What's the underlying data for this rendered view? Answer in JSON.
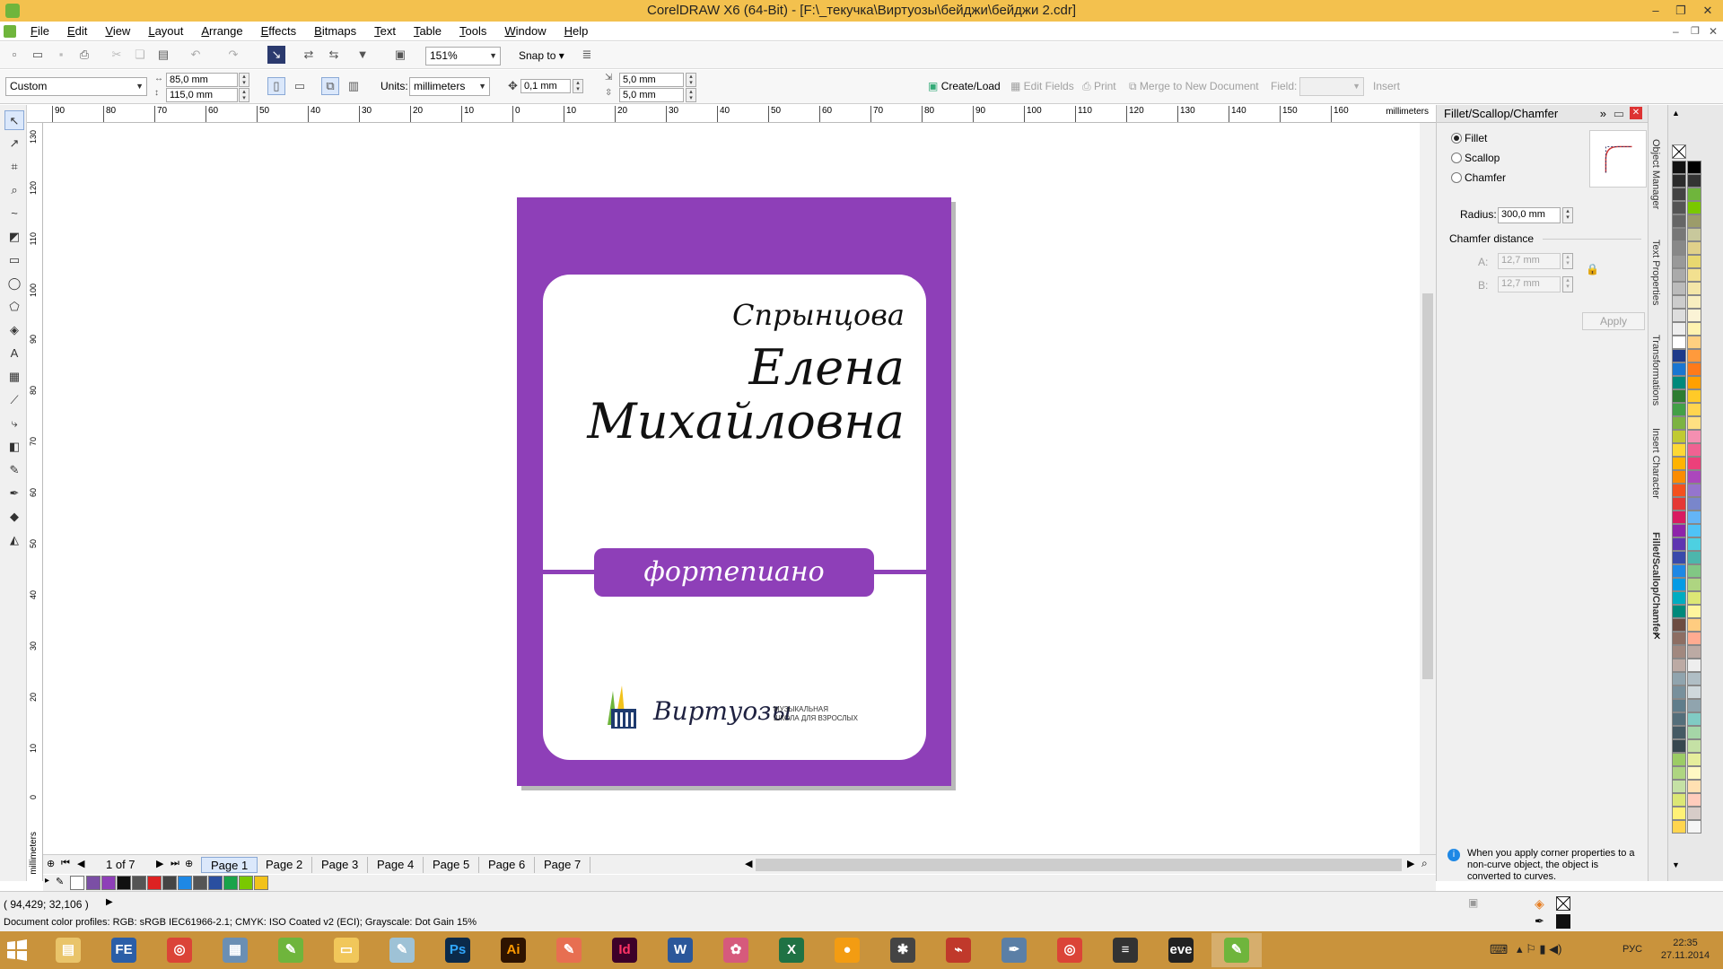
{
  "titlebar": {
    "title": "CorelDRAW X6 (64-Bit) - [F:\\_текучка\\Виртуозы\\бейджи\\бейджи 2.cdr]"
  },
  "menu": [
    "File",
    "Edit",
    "View",
    "Layout",
    "Arrange",
    "Effects",
    "Bitmaps",
    "Text",
    "Table",
    "Tools",
    "Window",
    "Help"
  ],
  "toolbar": {
    "zoom": "151%",
    "snap_to": "Snap to"
  },
  "propbar": {
    "preset": "Custom",
    "width": "85,0 mm",
    "height": "115,0 mm",
    "units_label": "Units:",
    "units": "millimeters",
    "nudge": "0,1 mm",
    "dup_x": "5,0 mm",
    "dup_y": "5,0 mm",
    "create_load": "Create/Load",
    "edit_fields": "Edit Fields",
    "print": "Print",
    "merge": "Merge to New Document",
    "field_label": "Field:",
    "insert": "Insert"
  },
  "rulers": {
    "h_ticks": [
      "90",
      "80",
      "70",
      "60",
      "50",
      "40",
      "30",
      "20",
      "10",
      "0",
      "10",
      "20",
      "30",
      "40",
      "50",
      "60",
      "70",
      "80",
      "90",
      "100",
      "110",
      "120",
      "130",
      "140",
      "150",
      "160"
    ],
    "units": "millimeters",
    "v_ticks": [
      "130",
      "120",
      "110",
      "100",
      "90",
      "80",
      "70",
      "60",
      "50",
      "40",
      "30",
      "20",
      "10",
      "0"
    ],
    "v_units": "millimeters"
  },
  "badge": {
    "surname": "Спрынцова",
    "first_name": "Елена",
    "patronymic": "Михайловна",
    "subject": "фортепиано",
    "logo_name": "Виртуозы",
    "logo_sub_1": "МУЗЫКАЛЬНАЯ",
    "logo_sub_2": "ШКОЛА ДЛЯ ВЗРОСЛЫХ",
    "colors": {
      "purple": "#8e3fb8",
      "white": "#ffffff"
    }
  },
  "pages": {
    "counter": "1 of 7",
    "tabs": [
      "Page 1",
      "Page 2",
      "Page 3",
      "Page 4",
      "Page 5",
      "Page 6",
      "Page 7"
    ],
    "active": 0
  },
  "docker": {
    "title": "Fillet/Scallop/Chamfer",
    "options": [
      "Fillet",
      "Scallop",
      "Chamfer"
    ],
    "selected": 0,
    "radius_label": "Radius:",
    "radius": "300,0 mm",
    "chamfer_label": "Chamfer distance",
    "a_label": "A:",
    "a_value": "12,7 mm",
    "b_label": "B:",
    "b_value": "12,7 mm",
    "apply": "Apply",
    "hint": "When you apply corner properties to a non-curve object, the object is converted to curves."
  },
  "side_tabs": [
    "Object Manager",
    "Text Properties",
    "Transformations",
    "Insert Character",
    "Fillet/Scallop/Chamfer"
  ],
  "status": {
    "coords": "( 94,429; 32,106 )",
    "profiles": "Document color profiles: RGB: sRGB IEC61966-2.1; CMYK: ISO Coated v2 (ECI); Grayscale: Dot Gain 15%"
  },
  "taskbar": {
    "apps": [
      "explorer",
      "fe",
      "chrome",
      "calculator",
      "corel-1",
      "folder",
      "notes",
      "Ps",
      "Ai",
      "pen",
      "Id",
      "W",
      "paint",
      "X",
      "bubble",
      "acrobat-figure",
      "pdf",
      "feather",
      "chrome-2",
      "list",
      "eve",
      "corel-2"
    ],
    "lang": "РУС",
    "time": "22:35",
    "date": "27.11.2014"
  }
}
